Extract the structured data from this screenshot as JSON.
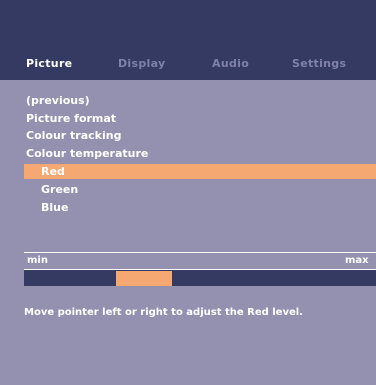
{
  "tabs": [
    {
      "label": "Picture",
      "active": true
    },
    {
      "label": "Display",
      "active": false
    },
    {
      "label": "Audio",
      "active": false
    },
    {
      "label": "Settings",
      "active": false
    }
  ],
  "menu": {
    "items": [
      {
        "label": "(previous)"
      },
      {
        "label": "Picture format"
      },
      {
        "label": "Colour tracking"
      },
      {
        "label": "Colour temperature"
      }
    ],
    "subitems": [
      {
        "label": "Red",
        "selected": true
      },
      {
        "label": "Green",
        "selected": false
      },
      {
        "label": "Blue",
        "selected": false
      }
    ]
  },
  "slider": {
    "min_label": "min",
    "max_label": "max",
    "level_fraction": 0.34
  },
  "hint": "Move pointer left or right to adjust the Red level.",
  "colors": {
    "background": "#9490b0",
    "header": "#343a62",
    "accent": "#f5a872",
    "inactive_tab": "#7f82a8",
    "text": "#ffffff"
  }
}
